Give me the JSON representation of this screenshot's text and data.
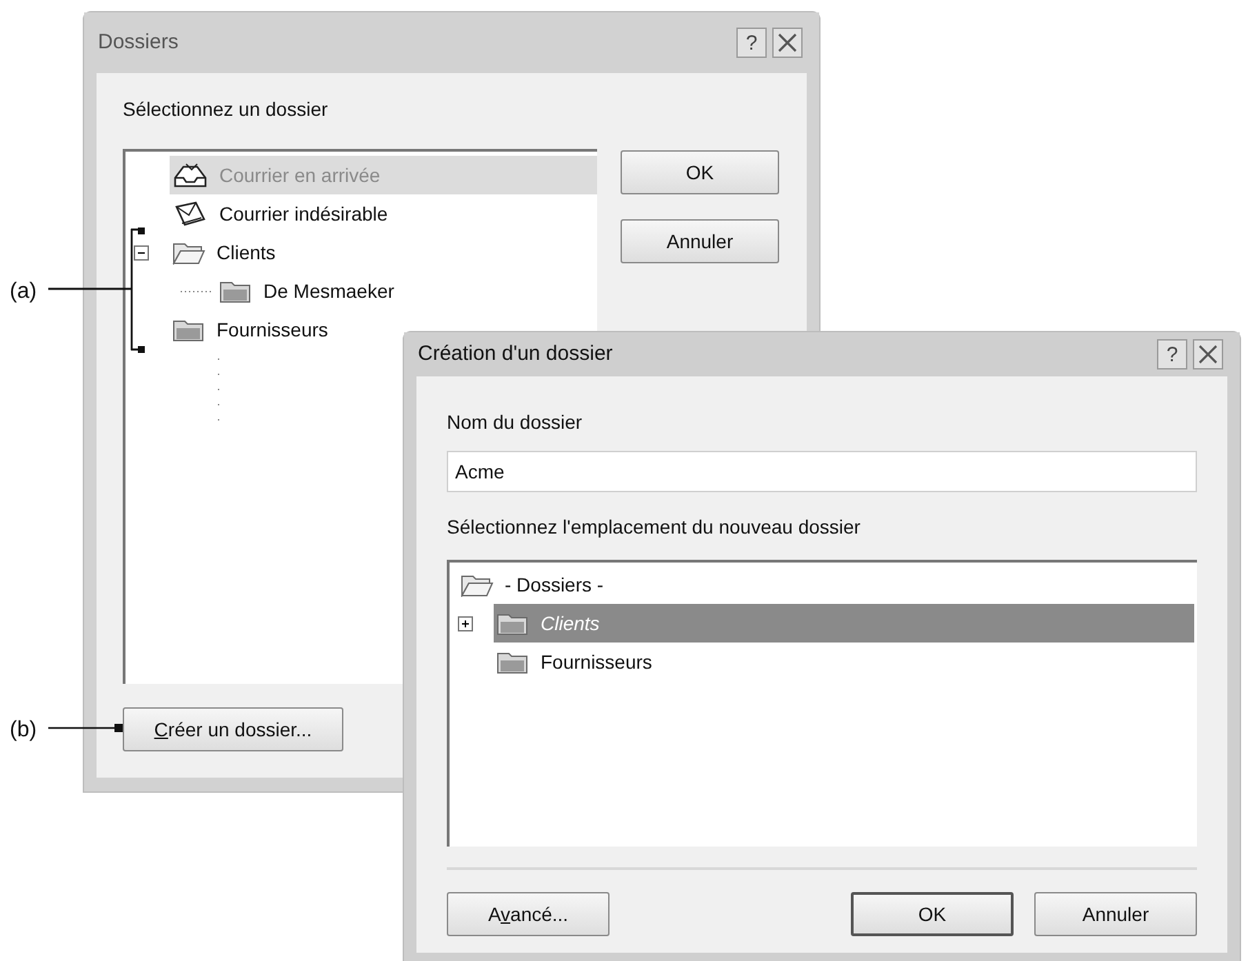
{
  "dialogs": [
    {
      "title": "Dossiers",
      "help_button": "?",
      "active": false,
      "prompt": "Sélectionnez un dossier",
      "tree": [
        {
          "label": "Courrier en arrivée",
          "kind": "inbox",
          "selected": true
        },
        {
          "label": "Courrier indésirable",
          "kind": "junk",
          "selected": false
        },
        {
          "label": "Clients",
          "kind": "folder",
          "selected": false,
          "expanded": true,
          "children": [
            {
              "label": "De Mesmaeker",
              "kind": "folder",
              "selected": false
            }
          ]
        },
        {
          "label": "Fournisseurs",
          "kind": "folder",
          "selected": false
        }
      ],
      "side_buttons": [
        {
          "label": "OK",
          "default": false
        },
        {
          "label": "Annuler",
          "default": false
        }
      ],
      "bottom_buttons": [
        {
          "label_parts": [
            {
              "text": "C",
              "underline": true
            },
            {
              "text": "réer un dossier...",
              "underline": false
            }
          ],
          "default": false
        }
      ]
    },
    {
      "title": "Création d'un dossier",
      "help_button": "?",
      "active": true,
      "name_label": "Nom du dossier",
      "name_value": "Acme",
      "prompt": "Sélectionnez l'emplacement du nouveau dossier",
      "tree": [
        {
          "label": "- Dossiers -",
          "kind": "root",
          "selected": false
        },
        {
          "label": "Clients",
          "kind": "folder",
          "selected": true,
          "expanded": false
        },
        {
          "label": "Fournisseurs",
          "kind": "folder",
          "selected": false
        }
      ],
      "bottom_buttons": [
        {
          "label_parts": [
            {
              "text": "A",
              "underline": false
            },
            {
              "text": "v",
              "underline": true
            },
            {
              "text": "ancé...",
              "underline": false
            }
          ],
          "default": false
        },
        {
          "label": "OK",
          "default": true
        },
        {
          "label": "Annuler",
          "default": false
        }
      ]
    }
  ],
  "callouts": [
    {
      "label": "(a)",
      "kind": "bracket"
    },
    {
      "label": "(b)",
      "kind": "pointer"
    }
  ]
}
